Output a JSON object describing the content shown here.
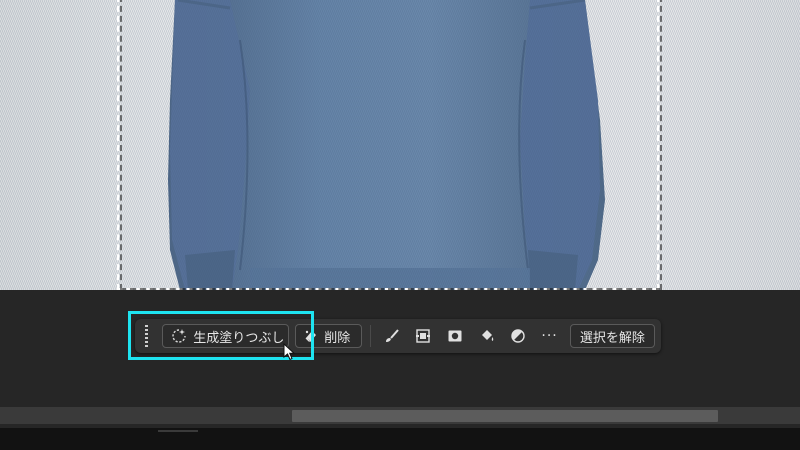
{
  "canvas": {
    "photo_subject": "person-wearing-blue-knit-sweater",
    "sweater_color": "#5f7c9e",
    "background_color": "#e6e7e9"
  },
  "taskbar": {
    "generative_fill_label": "生成塗りつぶし",
    "delete_label": "削除",
    "more_label": "···",
    "deselect_label": "選択を解除",
    "icons": [
      "sparkle-icon",
      "eraser-fill-icon",
      "brush-icon",
      "transform-icon",
      "mask-icon",
      "paint-bucket-icon",
      "adjustment-icon",
      "more-icon"
    ]
  },
  "colors": {
    "highlight": "#1ee3f0",
    "taskbar_bg": "#323232",
    "workspace_bg": "#262626",
    "text": "#e6e6e6"
  }
}
